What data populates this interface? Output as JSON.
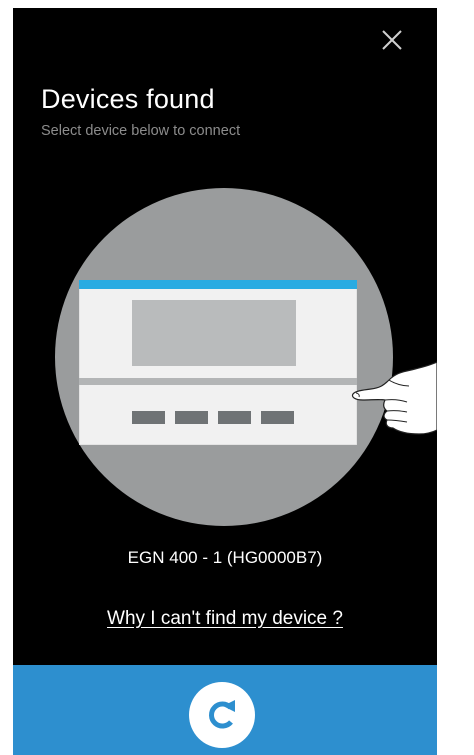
{
  "header": {
    "title": "Devices found",
    "subtitle": "Select device below to connect"
  },
  "device": {
    "name": "EGN 400 - 1 (HG0000B7)"
  },
  "help": {
    "link_text": "Why I can't find my device ?"
  },
  "icons": {
    "close": "close-icon",
    "hand": "pointing-hand-icon",
    "refresh": "refresh-icon"
  },
  "colors": {
    "background": "#000000",
    "device_circle": "#9a9c9d",
    "device_header": "#29abe2",
    "bottom_bar": "#2d8fcf",
    "refresh_icon": "#2d8fcf",
    "text": "#ffffff",
    "subtitle": "#8c8c8c"
  }
}
